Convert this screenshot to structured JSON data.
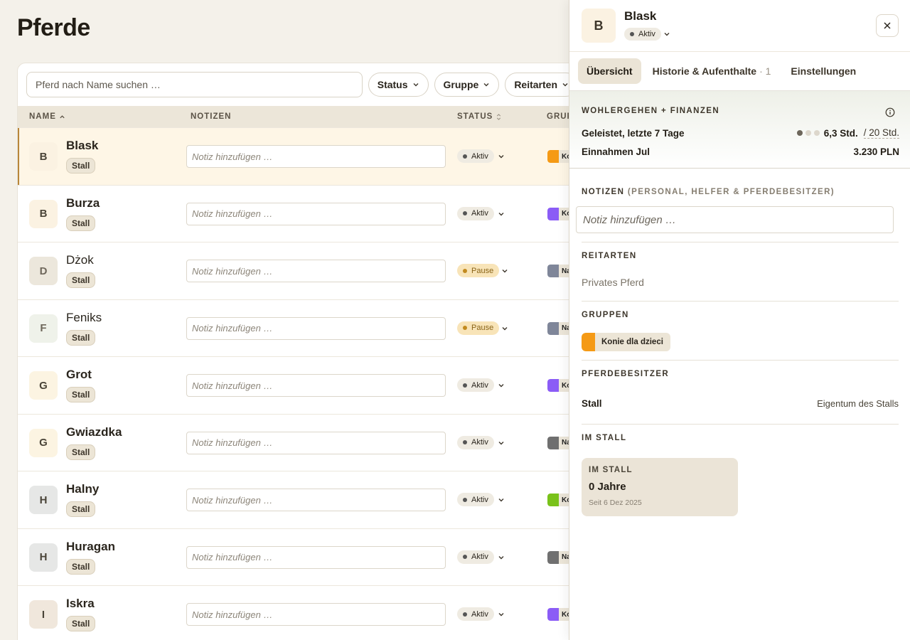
{
  "page": {
    "title": "Pferde"
  },
  "toolbar": {
    "search_placeholder": "Pferd nach Name suchen …",
    "filters": [
      "Status",
      "Gruppe",
      "Reitarten"
    ]
  },
  "table": {
    "columns": {
      "name": "NAME",
      "notes": "NOTIZEN",
      "status": "STATUS",
      "group": "GRUP"
    },
    "note_placeholder": "Notiz hinzufügen …",
    "rows": [
      {
        "initial": "B",
        "name": "Blask",
        "badge": "Stall",
        "status": "Aktiv",
        "status_kind": "active",
        "group_color": "#f59a15",
        "group_label": "Ko",
        "avatar_bg": "#fbf2e2",
        "selected": true
      },
      {
        "initial": "B",
        "name": "Burza",
        "badge": "Stall",
        "status": "Aktiv",
        "status_kind": "active",
        "group_color": "#8b5cf6",
        "group_label": "Ko",
        "avatar_bg": "#fbf2e2",
        "selected": false
      },
      {
        "initial": "D",
        "name": "Dżok",
        "badge": "Stall",
        "status": "Pause",
        "status_kind": "pause",
        "group_color": "#7f8699",
        "group_label": "Na",
        "avatar_bg": "#ece7dc",
        "selected": false
      },
      {
        "initial": "F",
        "name": "Feniks",
        "badge": "Stall",
        "status": "Pause",
        "status_kind": "pause",
        "group_color": "#7f8699",
        "group_label": "Na",
        "avatar_bg": "#eff2ea",
        "selected": false
      },
      {
        "initial": "G",
        "name": "Grot",
        "badge": "Stall",
        "status": "Aktiv",
        "status_kind": "active",
        "group_color": "#8b5cf6",
        "group_label": "Ko",
        "avatar_bg": "#fcf4e2",
        "selected": false
      },
      {
        "initial": "G",
        "name": "Gwiazdka",
        "badge": "Stall",
        "status": "Aktiv",
        "status_kind": "active",
        "group_color": "#6f6f6f",
        "group_label": "Na",
        "avatar_bg": "#fcf4e2",
        "selected": false
      },
      {
        "initial": "H",
        "name": "Halny",
        "badge": "Stall",
        "status": "Aktiv",
        "status_kind": "active",
        "group_color": "#79c21a",
        "group_label": "Ko",
        "avatar_bg": "#e6e7e6",
        "selected": false
      },
      {
        "initial": "H",
        "name": "Huragan",
        "badge": "Stall",
        "status": "Aktiv",
        "status_kind": "active",
        "group_color": "#707070",
        "group_label": "Na",
        "avatar_bg": "#e6e7e6",
        "selected": false
      },
      {
        "initial": "I",
        "name": "Iskra",
        "badge": "Stall",
        "status": "Aktiv",
        "status_kind": "active",
        "group_color": "#8b5cf6",
        "group_label": "Ko",
        "avatar_bg": "#f0e7dc",
        "selected": false
      }
    ]
  },
  "panel": {
    "initial": "B",
    "name": "Blask",
    "status": "Aktiv",
    "tabs": [
      {
        "label": "Übersicht",
        "count": ""
      },
      {
        "label": "Historie & Aufenthalte",
        "count": "· 1"
      },
      {
        "label": "Einstellungen",
        "count": ""
      }
    ],
    "wellbeing": {
      "title": "WOHLERGEHEN + FINANZEN",
      "worked_label": "Geleistet, letzte 7 Tage",
      "worked_value": "6,3 Std.",
      "worked_target": "/ 20 Std.",
      "worked_level": 1,
      "income_label": "Einnahmen Jul",
      "income_value": "3.230 PLN"
    },
    "notes": {
      "title": "NOTIZEN",
      "subtitle": "(PERSONAL, HELFER & PFERDEBESITZER)",
      "placeholder": "Notiz hinzufügen …"
    },
    "reitarten": {
      "title": "REITARTEN",
      "value": "Privates Pferd"
    },
    "gruppen": {
      "title": "GRUPPEN",
      "chip": "Konie dla dzieci",
      "chip_color": "#f59a15"
    },
    "owner": {
      "title": "PFERDEBESITZER",
      "name": "Stall",
      "value": "Eigentum des Stalls"
    },
    "stall": {
      "title": "IM STALL",
      "card_label": "IM STALL",
      "card_value": "0 Jahre",
      "card_since": "Seit 6 Dez 2025"
    }
  },
  "colors": {
    "active_dot": "#555555",
    "active_bg": "#efebe2",
    "pause_dot": "#c28a1e",
    "pause_bg": "#f8e4b8"
  }
}
